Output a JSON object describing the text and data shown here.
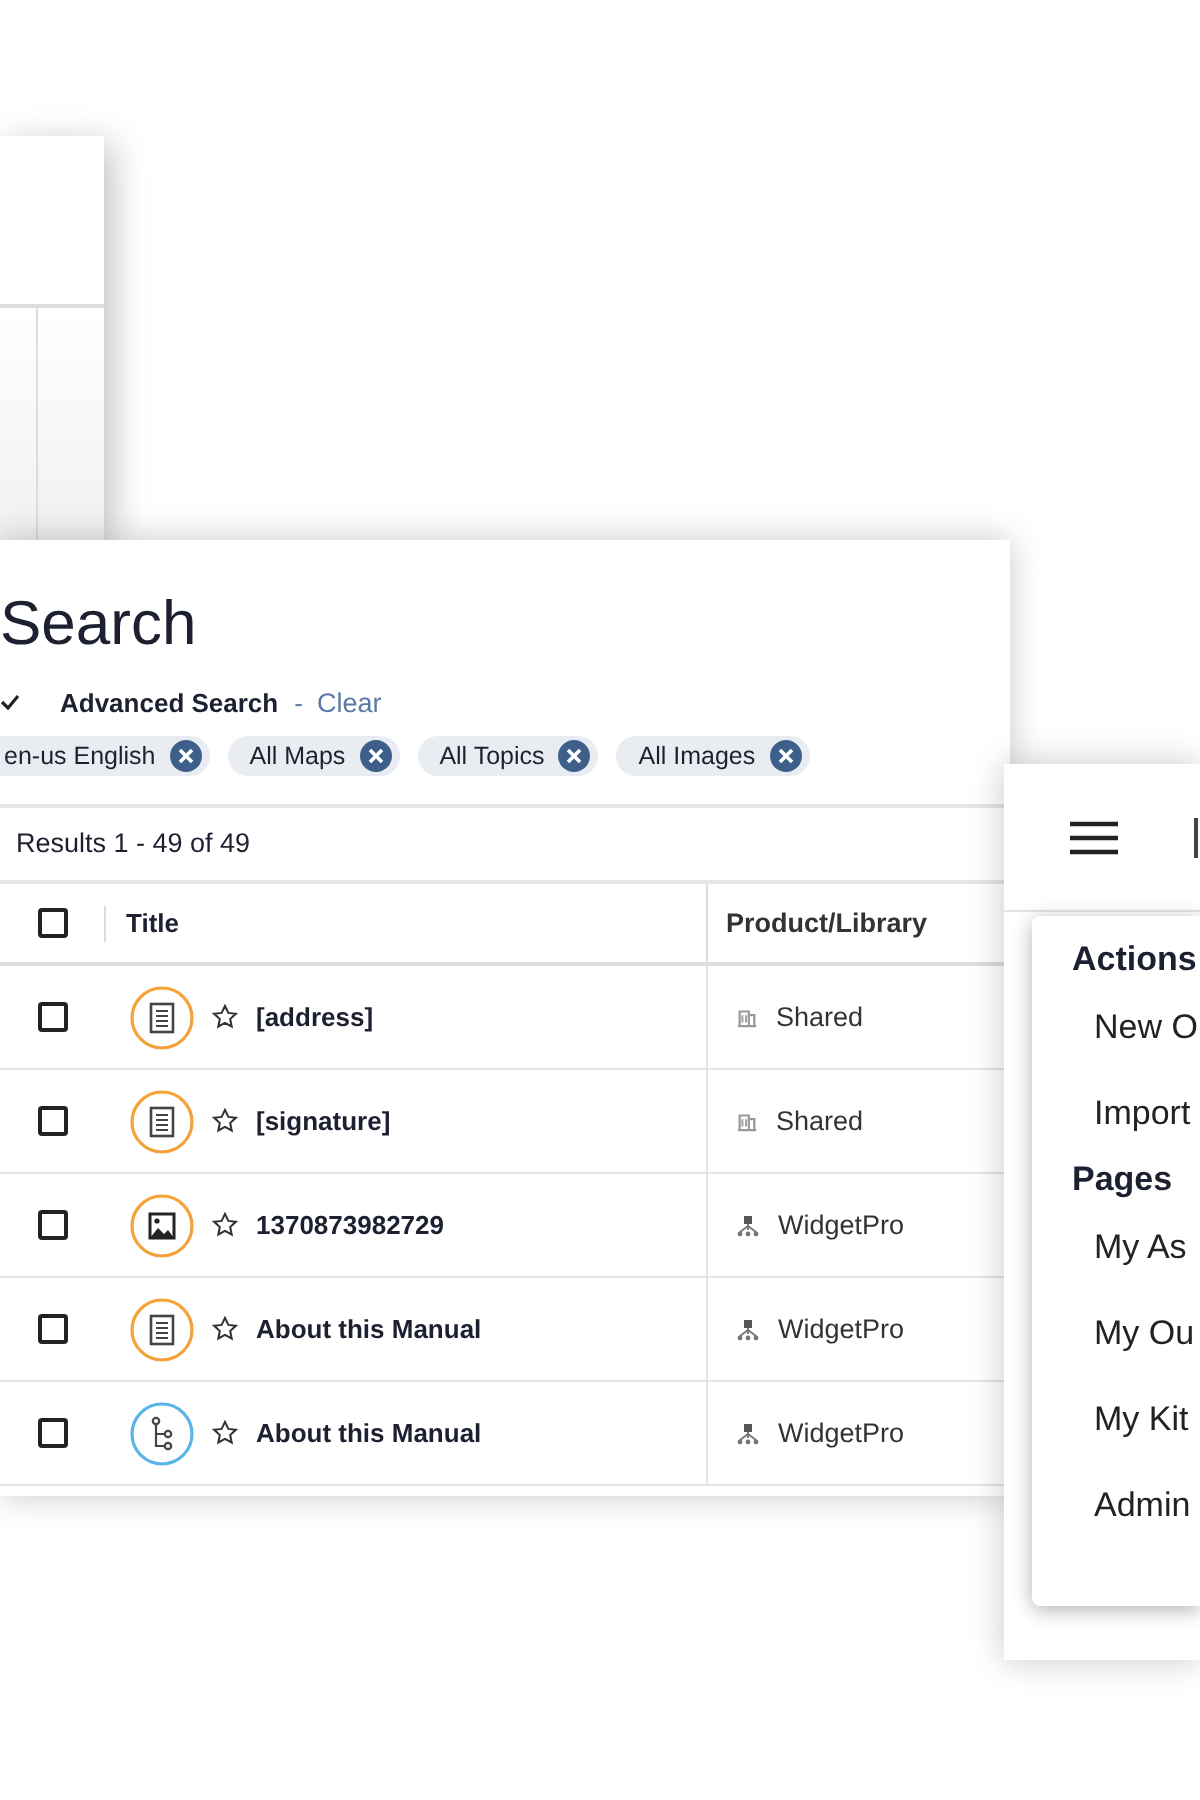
{
  "search_panel": {
    "title": "Search",
    "advanced": {
      "expanded": true,
      "label": "Advanced Search",
      "separator": "-",
      "clear": "Clear"
    },
    "filters": [
      {
        "label": "en-us English"
      },
      {
        "label": "All Maps"
      },
      {
        "label": "All Topics"
      },
      {
        "label": "All Images"
      }
    ],
    "results_count": "Results 1 - 49 of 49",
    "table": {
      "columns": [
        "Title",
        "Product/Library"
      ],
      "select_all": {
        "checked": false
      },
      "rows": [
        {
          "checked": false,
          "kind": "document",
          "starred": false,
          "title": "[address]",
          "library": {
            "kind": "shared",
            "name": "Shared"
          }
        },
        {
          "checked": false,
          "kind": "document",
          "starred": false,
          "title": "[signature]",
          "library": {
            "kind": "shared",
            "name": "Shared"
          }
        },
        {
          "checked": false,
          "kind": "image",
          "starred": false,
          "title": "1370873982729",
          "library": {
            "kind": "product",
            "name": "WidgetPro"
          }
        },
        {
          "checked": false,
          "kind": "document",
          "starred": false,
          "title": "About this Manual",
          "library": {
            "kind": "product",
            "name": "WidgetPro"
          }
        },
        {
          "checked": false,
          "kind": "map",
          "starred": false,
          "title": "About this Manual",
          "library": {
            "kind": "product",
            "name": "WidgetPro"
          }
        }
      ]
    }
  },
  "menu": {
    "sections": [
      {
        "heading": "Actions",
        "items": [
          "New O",
          "Import"
        ]
      },
      {
        "heading": "Pages",
        "items": [
          "My As",
          "My Ou",
          "My Kit",
          "Admin"
        ]
      }
    ]
  }
}
